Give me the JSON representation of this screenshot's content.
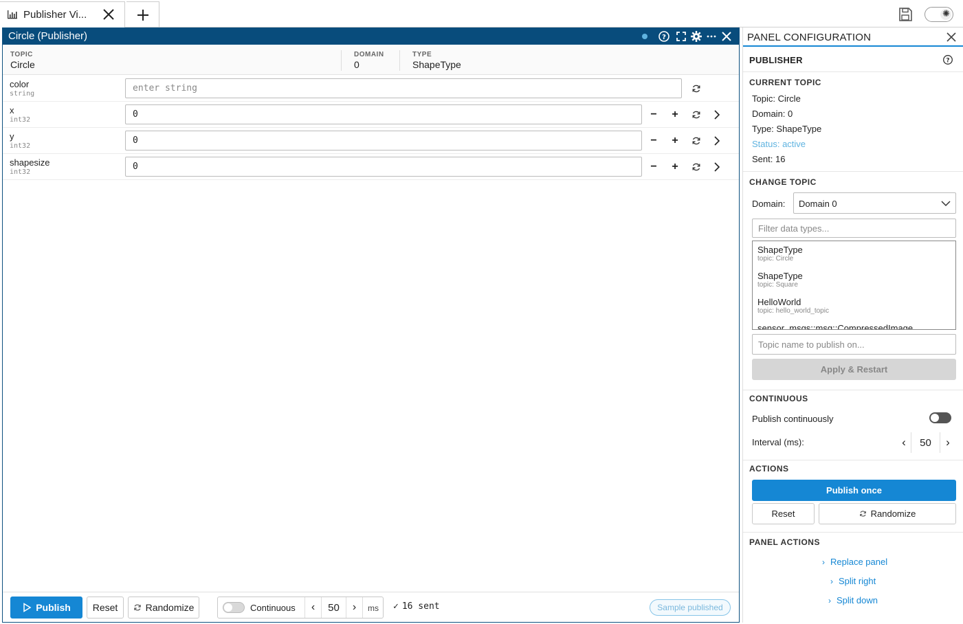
{
  "tabs": [
    {
      "title": "Publisher Vi..."
    }
  ],
  "panel": {
    "title": "Circle (Publisher)",
    "topic_label": "TOPIC",
    "topic": "Circle",
    "domain_label": "DOMAIN",
    "domain": "0",
    "type_label": "TYPE",
    "type": "ShapeType"
  },
  "fields": [
    {
      "name": "color",
      "type": "string",
      "value": "",
      "placeholder": "enter string"
    },
    {
      "name": "x",
      "type": "int32",
      "value": "0"
    },
    {
      "name": "y",
      "type": "int32",
      "value": "0"
    },
    {
      "name": "shapesize",
      "type": "int32",
      "value": "0"
    }
  ],
  "bottom": {
    "publish": "Publish",
    "reset": "Reset",
    "randomize": "Randomize",
    "continuous": "Continuous",
    "interval": "50",
    "ms": "ms",
    "sent": "16 sent",
    "badge": "Sample published"
  },
  "config": {
    "title": "PANEL CONFIGURATION",
    "section_title": "PUBLISHER",
    "current_topic": {
      "heading": "CURRENT TOPIC",
      "topic": "Topic: Circle",
      "domain": "Domain: 0",
      "type": "Type: ShapeType",
      "status": "Status: active",
      "sent": "Sent: 16"
    },
    "change_topic": {
      "heading": "CHANGE TOPIC",
      "domain_label": "Domain:",
      "domain_value": "Domain 0",
      "filter_placeholder": "Filter data types...",
      "types": [
        {
          "name": "ShapeType",
          "topic": "topic: Circle"
        },
        {
          "name": "ShapeType",
          "topic": "topic: Square"
        },
        {
          "name": "HelloWorld",
          "topic": "topic: hello_world_topic"
        },
        {
          "name": "sensor_msgs::msg::CompressedImage",
          "topic": ""
        }
      ],
      "topic_placeholder": "Topic name to publish on...",
      "apply": "Apply & Restart"
    },
    "continuous": {
      "heading": "CONTINUOUS",
      "publish_label": "Publish continuously",
      "interval_label": "Interval (ms):",
      "interval": "50"
    },
    "actions": {
      "heading": "ACTIONS",
      "publish_once": "Publish once",
      "reset": "Reset",
      "randomize": "Randomize"
    },
    "panel_actions": {
      "heading": "PANEL ACTIONS",
      "items": [
        "Replace panel",
        "Split right",
        "Split down"
      ]
    }
  },
  "colors": {
    "accent": "#1587d4",
    "header": "#084c7c",
    "status": "#5fb3e0"
  }
}
